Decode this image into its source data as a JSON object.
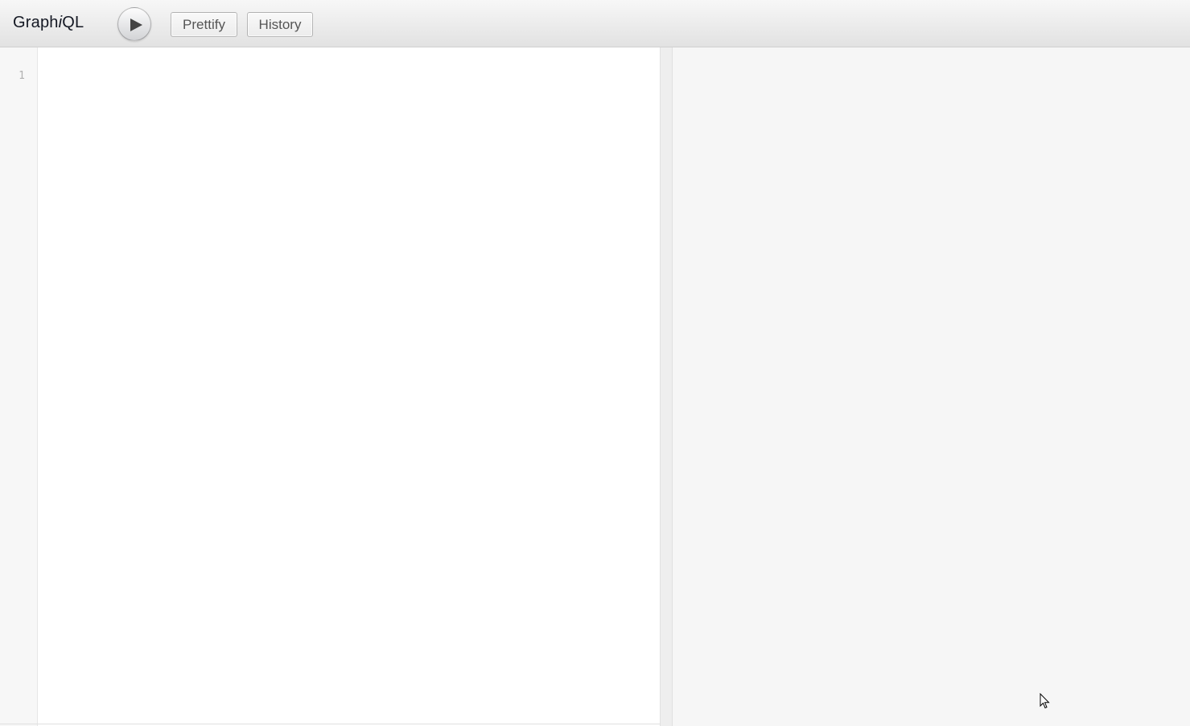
{
  "app": {
    "title_prefix": "Graph",
    "title_italic": "i",
    "title_suffix": "QL"
  },
  "toolbar": {
    "execute_icon": "play-icon",
    "prettify_label": "Prettify",
    "history_label": "History"
  },
  "query_editor": {
    "line_numbers": [
      "1"
    ],
    "content": ""
  },
  "result_pane": {
    "content": ""
  },
  "colors": {
    "topbar_top": "#f7f7f7",
    "topbar_bottom": "#e2e2e2",
    "editor_bg": "#ffffff",
    "gutter_bg": "#f7f7f7",
    "result_bg": "#f6f6f6",
    "title_text": "#141823"
  }
}
